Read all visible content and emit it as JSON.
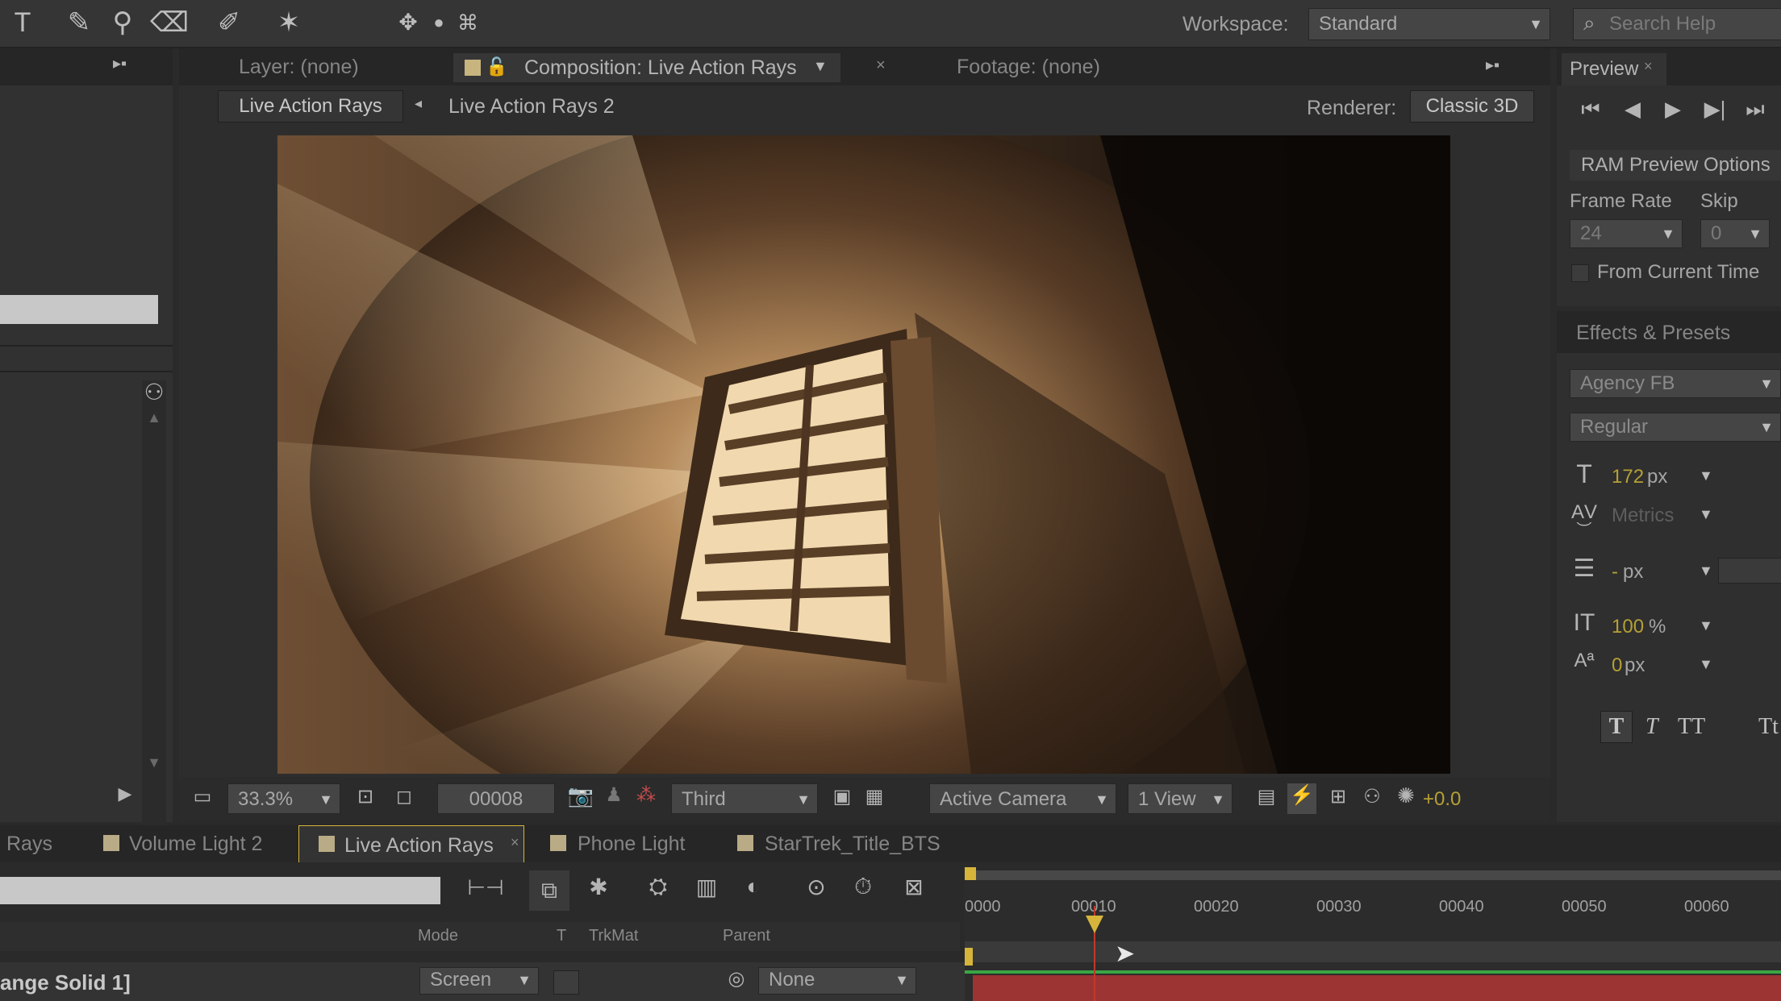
{
  "toolbar": {
    "tools": [
      "T",
      "✎",
      "⚲",
      "⌫",
      "✐",
      "✶",
      "✥",
      "●",
      "⌘"
    ],
    "workspace_label": "Workspace:",
    "workspace_value": "Standard",
    "search_placeholder": "Search Help"
  },
  "viewer": {
    "tabs": {
      "layer": "Layer: (none)",
      "composition": "Composition: Live Action Rays",
      "footage": "Footage: (none)"
    },
    "breadcrumb": [
      "Live Action Rays",
      "Live Action Rays 2"
    ],
    "renderer_label": "Renderer:",
    "renderer_value": "Classic 3D",
    "bottom": {
      "zoom": "33.3%",
      "timecode": "00008",
      "resolution": "Third",
      "camera": "Active Camera",
      "view": "1 View",
      "exposure": "+0.0"
    }
  },
  "preview": {
    "tab": "Preview",
    "ram_options": "RAM Preview Options",
    "frame_rate_label": "Frame Rate",
    "skip_label": "Skip",
    "frame_rate_value": "24",
    "skip_value": "0",
    "from_current_time": "From Current Time"
  },
  "effects": {
    "tab": "Effects & Presets",
    "font": "Agency FB",
    "style": "Regular",
    "font_size": "172",
    "font_size_unit": "px",
    "kerning": "Metrics",
    "leading_unit": "px",
    "leading_value": "-",
    "vscale": "100",
    "vscale_unit": "%",
    "baseline": "0",
    "baseline_unit": "px",
    "style_buttons": [
      "T",
      "T",
      "TT",
      "Tt"
    ]
  },
  "timeline": {
    "tabs": [
      "Rays",
      "Volume Light 2",
      "Live Action Rays",
      "Phone Light",
      "StarTrek_Title_BTS"
    ],
    "headers": {
      "mode": "Mode",
      "t": "T",
      "trkmat": "TrkMat",
      "parent": "Parent"
    },
    "layer": {
      "name": "ange Solid 1]",
      "mode": "Screen",
      "parent": "None"
    },
    "ruler": [
      "0000",
      "00010",
      "00020",
      "00030",
      "00040",
      "00050",
      "00060"
    ]
  },
  "colors": {
    "accent_yellow": "#d6b53a",
    "track_red": "#9d3434",
    "track_green": "#3aa544",
    "image_highlight": "#f3d8ad"
  }
}
